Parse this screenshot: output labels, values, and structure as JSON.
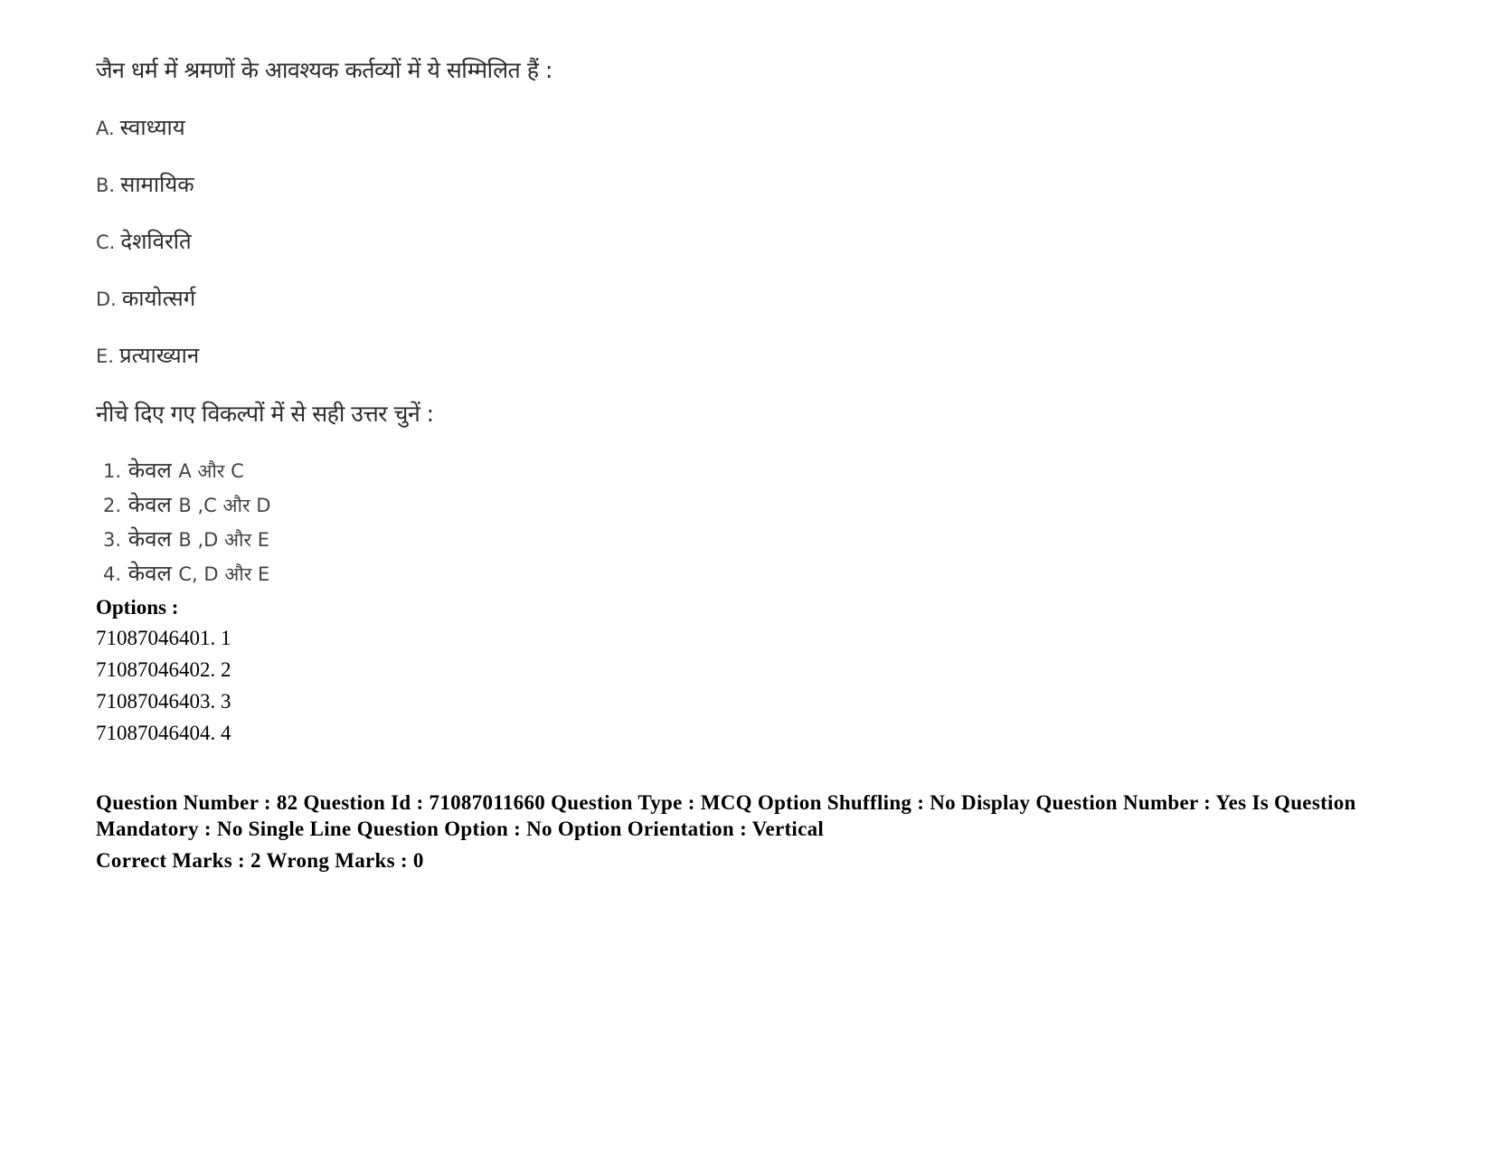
{
  "question": {
    "prompt": "जैन धर्म में श्रमणों के आवश्यक कर्तव्यों में ये सम्मिलित हैं :",
    "statements": [
      {
        "letter": "A.",
        "text": "स्वाध्याय"
      },
      {
        "letter": "B.",
        "text": "सामायिक"
      },
      {
        "letter": "C.",
        "text": "देशविरति"
      },
      {
        "letter": "D.",
        "text": "कायोत्सर्ग"
      },
      {
        "letter": "E.",
        "text": "प्रत्याख्यान"
      }
    ],
    "instruction": "नीचे दिए गए विकल्पों में से सही उत्तर चुनें :",
    "choices": [
      {
        "num": "1.",
        "word": "केवल",
        "tail": "A और C"
      },
      {
        "num": "2.",
        "word": "केवल",
        "tail": "B ,C और D"
      },
      {
        "num": "3.",
        "word": "केवल",
        "tail": "B ,D और E"
      },
      {
        "num": "4.",
        "word": "केवल",
        "tail": "C, D और E"
      }
    ]
  },
  "options": {
    "label": "Options :",
    "items": [
      "71087046401. 1",
      "71087046402. 2",
      "71087046403. 3",
      "71087046404. 4"
    ]
  },
  "metadata": {
    "line1": "Question Number : 82 Question Id : 71087011660 Question Type : MCQ Option Shuffling : No Display Question Number : Yes Is Question Mandatory : No Single Line Question Option : No Option Orientation : Vertical",
    "marks": "Correct Marks : 2 Wrong Marks : 0"
  }
}
